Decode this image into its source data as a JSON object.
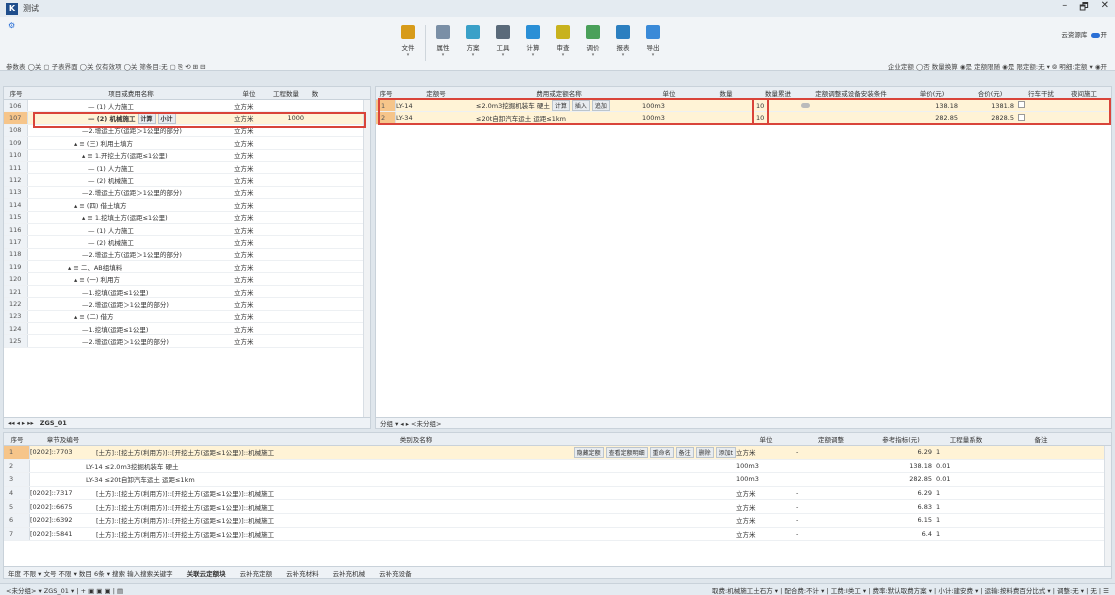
{
  "window": {
    "title": "测试",
    "cloud_lib": "云资源库",
    "min": "–",
    "max": "🗗",
    "close": "✕"
  },
  "ribbon": {
    "tools": [
      {
        "label": "文件",
        "icon": "file-icon",
        "color": "#d79b1a"
      },
      {
        "label": "属性",
        "icon": "properties-icon",
        "color": "#7a8fa6"
      },
      {
        "label": "方案",
        "icon": "scheme-icon",
        "color": "#3aa0c8"
      },
      {
        "label": "工具",
        "icon": "tools-icon",
        "color": "#5a6a7a"
      },
      {
        "label": "计算",
        "icon": "calculate-icon",
        "color": "#2a8fd6"
      },
      {
        "label": "审查",
        "icon": "review-icon",
        "color": "#c8b21e"
      },
      {
        "label": "调价",
        "icon": "price-adjust-icon",
        "color": "#4aa05a"
      },
      {
        "label": "报表",
        "icon": "report-icon",
        "color": "#2c7fc0"
      },
      {
        "label": "导出",
        "icon": "export-icon",
        "color": "#3a8ad8"
      }
    ],
    "left_options": "参数表 ◯关 ▢ 子表界面 ◯关 仅有效项 ◯关 筛条目:无 ▢ ⎘ ⟲ ⊞ ⊟",
    "right_options": "企业定额 ◯否 数量换算 ◉是 定额限随 ◉是 限定额:无 ▾ ⦾ 明细:定额 ▾ ◉开"
  },
  "left": {
    "headers": [
      "序号",
      "项目或费用名称",
      "单位",
      "工程数量",
      "数"
    ],
    "rows": [
      {
        "n": "106",
        "name": "— (1) 人力施工",
        "indent": 60,
        "unit": "立方米",
        "qty": ""
      },
      {
        "n": "107",
        "name": "— (2) 机械施工",
        "indent": 60,
        "unit": "立方米",
        "qty": "1000",
        "sel": true,
        "btns": [
          "计算",
          "小计"
        ]
      },
      {
        "n": "108",
        "name": "—2.增运土方(运距＞1公里的部分)",
        "indent": 54,
        "unit": "立方米",
        "qty": ""
      },
      {
        "n": "109",
        "name": "▴ ≡ (三) 利用土填方",
        "indent": 46,
        "unit": "立方米",
        "qty": ""
      },
      {
        "n": "110",
        "name": "▴ ≡ 1.开挖土方(运距≤1公里)",
        "indent": 54,
        "unit": "立方米",
        "qty": ""
      },
      {
        "n": "111",
        "name": "— (1) 人力施工",
        "indent": 60,
        "unit": "立方米",
        "qty": ""
      },
      {
        "n": "112",
        "name": "— (2) 机械施工",
        "indent": 60,
        "unit": "立方米",
        "qty": ""
      },
      {
        "n": "113",
        "name": "—2.增运土方(运距＞1公里的部分)",
        "indent": 54,
        "unit": "立方米",
        "qty": ""
      },
      {
        "n": "114",
        "name": "▴ ≡ (四) 借土填方",
        "indent": 46,
        "unit": "立方米",
        "qty": ""
      },
      {
        "n": "115",
        "name": "▴ ≡ 1.挖填土方(运距≤1公里)",
        "indent": 54,
        "unit": "立方米",
        "qty": ""
      },
      {
        "n": "116",
        "name": "— (1) 人力施工",
        "indent": 60,
        "unit": "立方米",
        "qty": ""
      },
      {
        "n": "117",
        "name": "— (2) 机械施工",
        "indent": 60,
        "unit": "立方米",
        "qty": ""
      },
      {
        "n": "118",
        "name": "—2.增运土方(运距＞1公里的部分)",
        "indent": 54,
        "unit": "立方米",
        "qty": ""
      },
      {
        "n": "119",
        "name": "▴ ≡ 二、AB组填料",
        "indent": 40,
        "unit": "立方米",
        "qty": ""
      },
      {
        "n": "120",
        "name": "▴ ≡ (一) 利用方",
        "indent": 46,
        "unit": "立方米",
        "qty": ""
      },
      {
        "n": "121",
        "name": "—1.挖填(运距≤1公里)",
        "indent": 54,
        "unit": "立方米",
        "qty": ""
      },
      {
        "n": "122",
        "name": "—2.增运(运距＞1公里的部分)",
        "indent": 54,
        "unit": "立方米",
        "qty": ""
      },
      {
        "n": "123",
        "name": "▴ ≡ (二) 借方",
        "indent": 46,
        "unit": "立方米",
        "qty": ""
      },
      {
        "n": "124",
        "name": "—1.挖填(运距≤1公里)",
        "indent": 54,
        "unit": "立方米",
        "qty": ""
      },
      {
        "n": "125",
        "name": "—2.增运(运距＞1公里的部分)",
        "indent": 54,
        "unit": "立方米",
        "qty": ""
      }
    ],
    "tab": "ZGS_01",
    "nav": "◂◂ ◂ ▸ ▸▸"
  },
  "right": {
    "headers": [
      "序号",
      "定额号",
      "费用或定额名称",
      "单位",
      "数量",
      "数量累进",
      "定额调整或设备安装条件",
      "单价(元)",
      "合价(元)",
      "行车干扰",
      "夜间施工"
    ],
    "rows": [
      {
        "n": "1",
        "code": "LY-14",
        "name": "≤2.0m3挖掘机装车 硬土",
        "btns": [
          "计算",
          "插入",
          "追加"
        ],
        "unit": "100m3",
        "prog": "10",
        "price": "138.18",
        "total": "1381.8"
      },
      {
        "n": "2",
        "code": "LY-34",
        "name": "≤20t自卸汽车运土 运距≤1km",
        "btns": [],
        "unit": "100m3",
        "prog": "10",
        "price": "282.85",
        "total": "2828.5"
      }
    ],
    "tabbar": "分组 ▾ ◂ ▸  <未分组>"
  },
  "bottom": {
    "headers": [
      "序号",
      "章节及编号",
      "类别及名称",
      "单位",
      "定额调整",
      "参考指标(元)",
      "工程量系数",
      "备注"
    ],
    "rows": [
      {
        "n": "1",
        "code": "[0202]::7703",
        "name": "[土方]::[挖土方(利用方)]::[开挖土方(运距≤1公里)]::机械施工",
        "unit": "立方米",
        "adj": "-",
        "ref": "6.29",
        "coef": "1",
        "sel": true,
        "btns": [
          "隐藏定额",
          "查看定额明细",
          "重命名",
          "备注",
          "删除",
          "添加t"
        ]
      },
      {
        "n": "2",
        "code": "LY-14",
        "name": "≤2.0m3挖掘机装车 硬土",
        "unit": "100m3",
        "adj": "",
        "ref": "138.18",
        "coef": "0.01",
        "sub": true
      },
      {
        "n": "3",
        "code": "LY-34",
        "name": "≤20t自卸汽车运土 运距≤1km",
        "unit": "100m3",
        "adj": "",
        "ref": "282.85",
        "coef": "0.01",
        "sub": true
      },
      {
        "n": "4",
        "code": "[0202]::7317",
        "name": "[土方]::[挖土方(利用方)]::[开挖土方(运距≤1公里)]::机械施工",
        "unit": "立方米",
        "adj": "-",
        "ref": "6.29",
        "coef": "1"
      },
      {
        "n": "5",
        "code": "[0202]::6675",
        "name": "[土方]::[挖土方(利用方)]::[开挖土方(运距≤1公里)]::机械施工",
        "unit": "立方米",
        "adj": "-",
        "ref": "6.83",
        "coef": "1"
      },
      {
        "n": "6",
        "code": "[0202]::6392",
        "name": "[土方]::[挖土方(利用方)]::[开挖土方(运距≤1公里)]::机械施工",
        "unit": "立方米",
        "adj": "-",
        "ref": "6.15",
        "coef": "1"
      },
      {
        "n": "7",
        "code": "[0202]::5841",
        "name": "[土方]::[挖土方(利用方)]::[开挖土方(运距≤1公里)]::机械施工",
        "unit": "立方米",
        "adj": "-",
        "ref": "6.4",
        "coef": "1"
      }
    ],
    "filter": "年度 不限 ▾ 文号 不限  ▾ 数目 6条  ▾ 搜索 输入搜索关键字",
    "tabs": [
      "关联云定额块",
      "云补充定额",
      "云补充材料",
      "云补充机械",
      "云补充设备"
    ]
  },
  "status": {
    "left": "<未分组> ▾  ZGS_01 ▾ | + ▣ ▣ ▣ | ▤",
    "right": "取费:机械施工土石方 ▾ | 配合费:不计 ▾ | 工费:Ⅰ类工 ▾ | 费率:默认取费方案 ▾ | 小计:建安费 ▾ | 运输:按料费百分比式 ▾ | 调整:无 ▾ | 无 | ☰"
  }
}
